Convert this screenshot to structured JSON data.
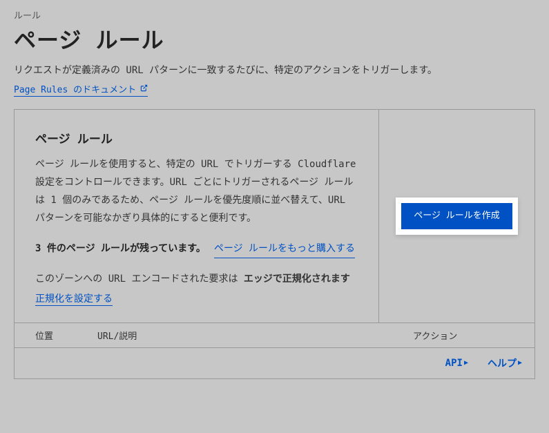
{
  "breadcrumb": "ルール",
  "title": "ページ ルール",
  "subtitle": "リクエストが定義済みの URL パターンに一致するたびに、特定のアクションをトリガーします。",
  "doc_link_label": "Page Rules のドキュメント",
  "panel": {
    "heading": "ページ ルール",
    "description": "ページ ルールを使用すると、特定の URL でトリガーする Cloudflare 設定をコントロールできます。URL ごとにトリガーされるページ ルールは 1 個のみであるため、ページ ルールを優先度順に並べ替えて、URL パターンを可能なかぎり具体的にすると便利です。",
    "remaining_text": "3 件のページ ルールが残っています。",
    "buy_more_link": "ページ ルールをもっと購入する",
    "encode_prefix": "このゾーンへの URL エンコードされた要求は ",
    "encode_bold": "エッジで正規化されます",
    "normalize_link": "正規化を設定する",
    "create_button": "ページ ルールを作成"
  },
  "table": {
    "col_position": "位置",
    "col_url": "URL/説明",
    "col_action": "アクション"
  },
  "footer": {
    "api": "API",
    "help": "ヘルプ"
  }
}
